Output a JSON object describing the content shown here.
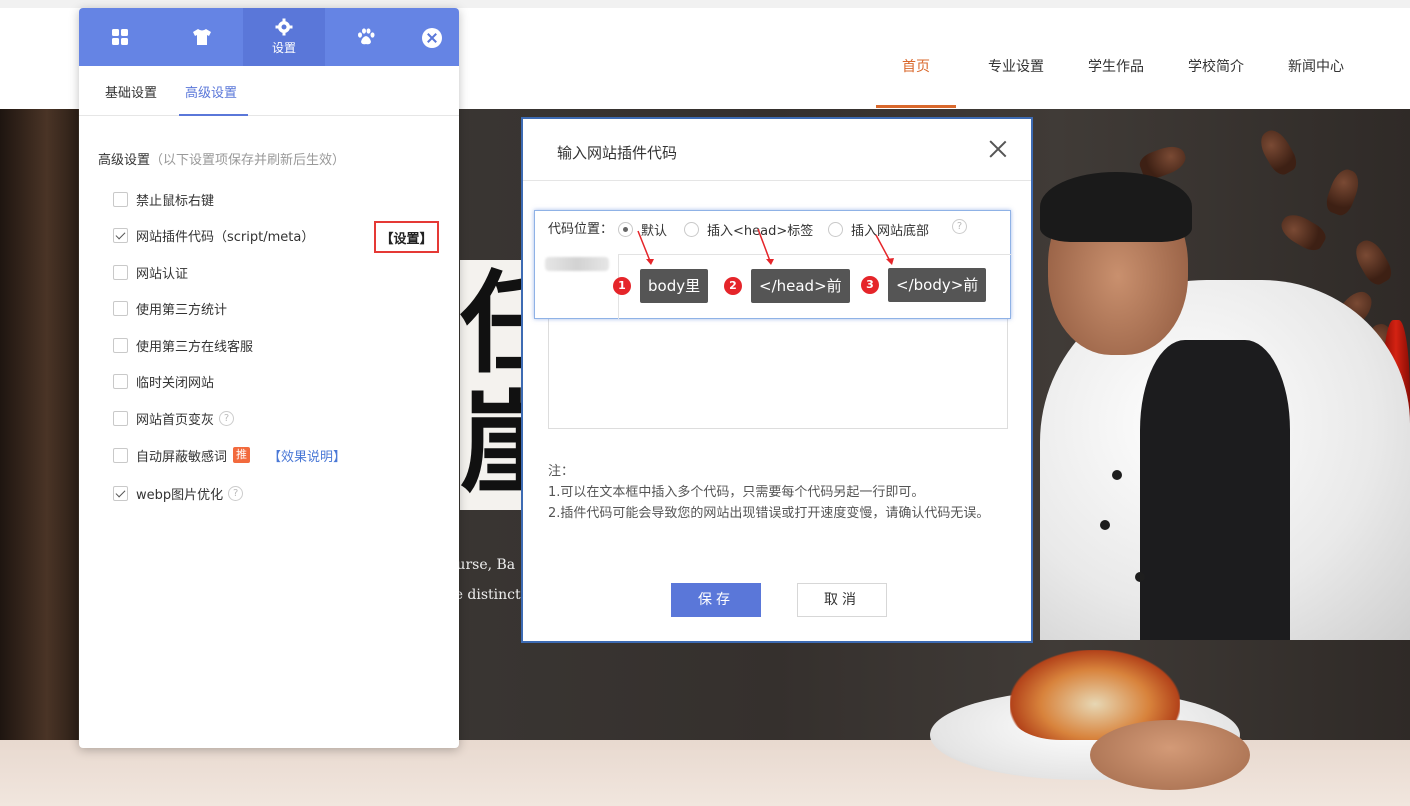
{
  "site_nav": {
    "items": [
      "首页",
      "专业设置",
      "学生作品",
      "学校简介",
      "新闻中心"
    ],
    "active_index": 0,
    "accent_color": "#d9682c"
  },
  "hero": {
    "char1": "任",
    "char2": "崖",
    "text_line1": "ourse,  Ba",
    "text_line2": "re distinct"
  },
  "panel": {
    "tabs": [
      {
        "icon": "grid-icon",
        "label": ""
      },
      {
        "icon": "shirt-icon",
        "label": ""
      },
      {
        "icon": "gear-icon",
        "label": "设置"
      },
      {
        "icon": "paw-icon",
        "label": ""
      }
    ],
    "subtabs": [
      "基础设置",
      "高级设置"
    ],
    "active_subtab": 1,
    "section_title": "高级设置",
    "section_hint": "（以下设置项保存并刷新后生效）",
    "options": [
      {
        "label": "禁止鼠标右键",
        "checked": false
      },
      {
        "label": "网站插件代码（script/meta）",
        "checked": true
      },
      {
        "label": "网站认证",
        "checked": false
      },
      {
        "label": "使用第三方统计",
        "checked": false
      },
      {
        "label": "使用第三方在线客服",
        "checked": false
      },
      {
        "label": "临时关闭网站",
        "checked": false
      },
      {
        "label": "网站首页变灰",
        "checked": false,
        "help": "?"
      },
      {
        "label": "自动屏蔽敏感词",
        "checked": false,
        "badge": "推",
        "link": "【效果说明】"
      },
      {
        "label": "webp图片优化",
        "checked": true,
        "help": "?"
      }
    ],
    "set_link": "【设置】",
    "accent_color": "#5a77d9"
  },
  "dialog": {
    "title": "输入网站插件代码",
    "position_label": "代码位置：",
    "radios": [
      {
        "label": "默认",
        "selected": true
      },
      {
        "label": "插入<head>标签",
        "selected": false
      },
      {
        "label": "插入网站底部",
        "selected": false
      }
    ],
    "help": "?",
    "tips": [
      {
        "num": "1",
        "text": "body里"
      },
      {
        "num": "2",
        "text": "</head>前"
      },
      {
        "num": "3",
        "text": "</body>前"
      }
    ],
    "notes_title": "注：",
    "note1": "1.可以在文本框中插入多个代码，只需要每个代码另起一行即可。",
    "note2": "2.插件代码可能会导致您的网站出现错误或打开速度变慢，请确认代码无误。",
    "save": "保存",
    "cancel": "取消",
    "border_color": "#3d6bb3",
    "tip_number_color": "#e5252a"
  }
}
